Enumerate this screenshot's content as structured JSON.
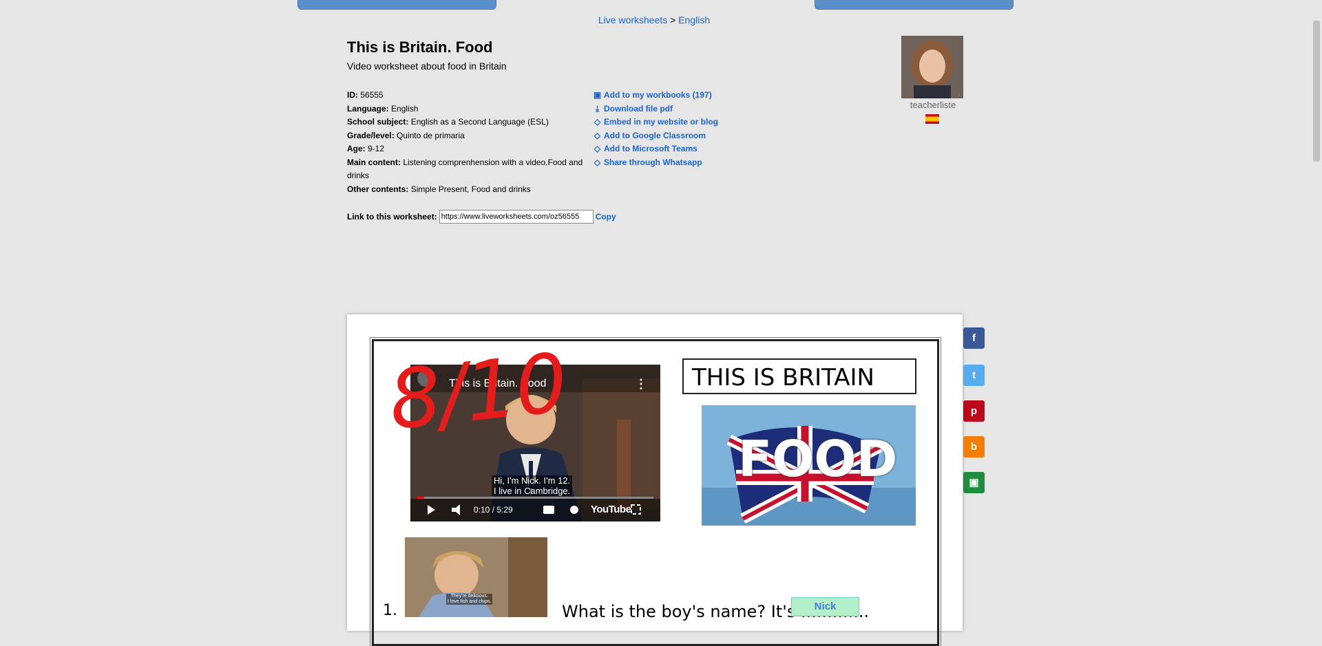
{
  "breadcrumb": {
    "site": "Live worksheets",
    "separator": ">",
    "section": "English"
  },
  "worksheet": {
    "title": "This is Britain. Food",
    "subtitle": "Video worksheet about food in Britain",
    "meta": [
      {
        "label": "ID:",
        "value": "56555"
      },
      {
        "label": "Language:",
        "value": "English"
      },
      {
        "label": "School subject:",
        "value": "English as a Second Language (ESL)"
      },
      {
        "label": "Grade/level:",
        "value": "Quinto de primaria"
      },
      {
        "label": "Age:",
        "value": "9-12"
      },
      {
        "label": "Main content:",
        "value": "Listening comprenhension with a video.Food and drinks"
      },
      {
        "label": "Other contents:",
        "value": "Simple Present, Food and drinks"
      }
    ],
    "link_label": "Link to this worksheet:",
    "link_value": "https://www.liveworksheets.com/oz56555",
    "copy_label": "Copy"
  },
  "actions": [
    {
      "label": "Add to my workbooks (197)",
      "icon": "workbook-icon"
    },
    {
      "label": "Download file pdf",
      "icon": "download-icon"
    },
    {
      "label": "Embed in my website or blog",
      "icon": "embed-icon"
    },
    {
      "label": "Add to Google Classroom",
      "icon": "embed-icon"
    },
    {
      "label": "Add to Microsoft Teams",
      "icon": "embed-icon"
    },
    {
      "label": "Share through Whatsapp",
      "icon": "embed-icon"
    }
  ],
  "author": {
    "username": "teacherliste",
    "flag": "spain-flag-icon"
  },
  "sheet": {
    "video": {
      "title": "This is Britain. Food",
      "subtitle_line1": "Hi, I'm Nick. I'm 12.",
      "subtitle_line2": "I live in Cambridge.",
      "time": "0:10 / 5:29",
      "brand": "YouTube",
      "progress": 0.03
    },
    "heading": "THIS IS BRITAIN",
    "food_word": "FOOD",
    "thumb_caption_1": "They're delicious.",
    "thumb_caption_2": "I love fish and chips.",
    "question_number": "1.",
    "question_text": "What is the boy's name? It's .............",
    "answer": "Nick",
    "score": "8/10"
  },
  "share_buttons": [
    {
      "name": "facebook",
      "glyph": "f",
      "color": "#3b5998"
    },
    {
      "name": "twitter",
      "glyph": "t",
      "color": "#55acee"
    },
    {
      "name": "pinterest",
      "glyph": "p",
      "color": "#bd081c"
    },
    {
      "name": "blogger",
      "glyph": "b",
      "color": "#f57d00"
    },
    {
      "name": "google-classroom",
      "glyph": "▣",
      "color": "#1e8e3e"
    }
  ]
}
